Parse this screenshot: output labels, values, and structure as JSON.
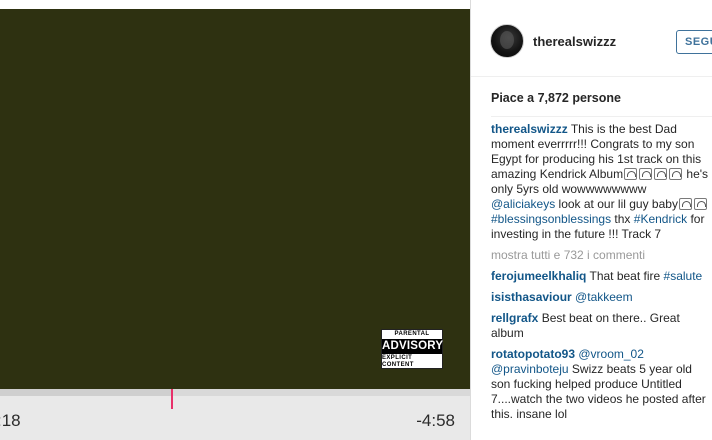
{
  "player": {
    "elapsed": ":18",
    "remaining": "-4:58",
    "progress_percent": 36.5,
    "advisory": {
      "top": "PARENTAL",
      "middle": "ADVISORY",
      "bottom": "EXPLICIT CONTENT"
    }
  },
  "post": {
    "username": "therealswizzz",
    "follow_label": "SEGUI",
    "likes": "Piace a 7,872 persone",
    "caption": {
      "user": "therealswizzz",
      "text_a": "This is the best Dad moment everrrrr!!! Congrats to my son Egypt for producing his 1st track on this amazing Kendrick Album",
      "text_b": " he's only 5yrs old wowwwwwwww ",
      "mention": "@aliciakeys",
      "text_c": " look at our lil guy baby",
      "hashtag1": "#blessingsonblessings",
      "text_d": " thx ",
      "hashtag2": "#Kendrick",
      "text_e": " for investing in the future !!! Track 7"
    },
    "view_all": "mostra tutti e 732 i commenti",
    "comments": [
      {
        "user": "ferojumeelkhaliq",
        "text": " That beat fire ",
        "tag": "#salute"
      },
      {
        "user": "isisthasaviour",
        "mention": "@takkeem"
      },
      {
        "user": "rellgrafx",
        "text": " Best beat on there.. Great album"
      },
      {
        "user": "rotatopotato93",
        "mention": "@vroom_02",
        "mention2": "@pravinboteju",
        "text": " Swizz beats 5 year old son fucking helped produce Untitled 7....watch the two videos he posted after this. insane lol"
      }
    ]
  },
  "icons": {
    "advisory": "parental-advisory-label",
    "emoji": "headphone-emoji"
  }
}
